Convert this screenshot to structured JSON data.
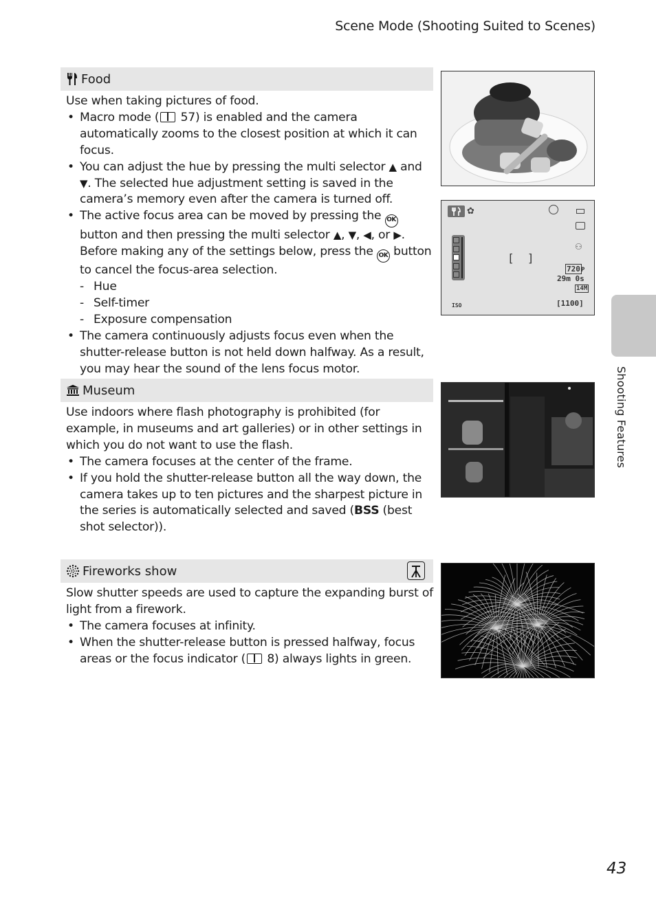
{
  "running_head": "Scene Mode (Shooting Suited to Scenes)",
  "side_tab_label": "Shooting Features",
  "page_number": "43",
  "sections": {
    "food": {
      "icon": "fork-knife-icon",
      "title": "Food",
      "intro": "Use when taking pictures of food.",
      "b1_pre": "Macro mode (",
      "b1_ref": "57",
      "b1_post": ") is enabled and the camera automatically zooms to the closest position at which it can focus.",
      "b2_pre": "You can adjust the hue by pressing the multi selector",
      "b2_and": "and",
      "b2_post": ". The selected hue adjustment setting is saved in the camera’s memory even after the camera is turned off.",
      "b3_pre": "The active focus area can be moved by pressing the",
      "b3_mid": "button and then pressing the multi selector",
      "b3_or": ", or",
      "b3_post": "Before making any of the settings below, press the",
      "b3_end": "button to cancel the focus-area selection.",
      "sub_items": [
        "Hue",
        "Self-timer",
        "Exposure compensation"
      ],
      "b4": "The camera continuously adjusts focus even when the shutter-release button is not held down halfway. As a result, you may hear the sound of the lens focus motor.",
      "ok_label": "OK"
    },
    "museum": {
      "icon": "museum-icon",
      "title": "Museum",
      "intro": "Use indoors where flash photography is prohibited (for example, in museums and art galleries) or in other settings in which you do not want to use the flash.",
      "b1": "The camera focuses at the center of the frame.",
      "b2_pre": "If you hold the shutter-release button all the way down, the camera takes up to ten pictures and the sharpest picture in the series is automatically selected and saved (",
      "b2_bold": "BSS",
      "b2_post": " (best shot selector))."
    },
    "fireworks": {
      "icon": "fireworks-icon",
      "badge_icon": "tripod-icon",
      "title": "Fireworks show",
      "intro": "Slow shutter speeds are used to capture the expanding burst of light from a firework.",
      "b1": "The camera focuses at infinity.",
      "b2_pre": "When the shutter-release button is pressed halfway, focus areas or the focus indicator (",
      "b2_ref": "8",
      "b2_post": ") always lights in green."
    }
  },
  "lcd": {
    "video_mode": "720",
    "video_suffix": "P",
    "remaining_time": "29m 0s",
    "image_size": "14M",
    "exposures_remaining": "[1100]",
    "iso_label": "ISO",
    "hue_level": 3,
    "hue_steps": 5
  },
  "photos": {
    "food_alt": "Food photograph",
    "museum_alt": "Museum interior photograph",
    "fireworks_alt": "Fireworks photograph"
  }
}
